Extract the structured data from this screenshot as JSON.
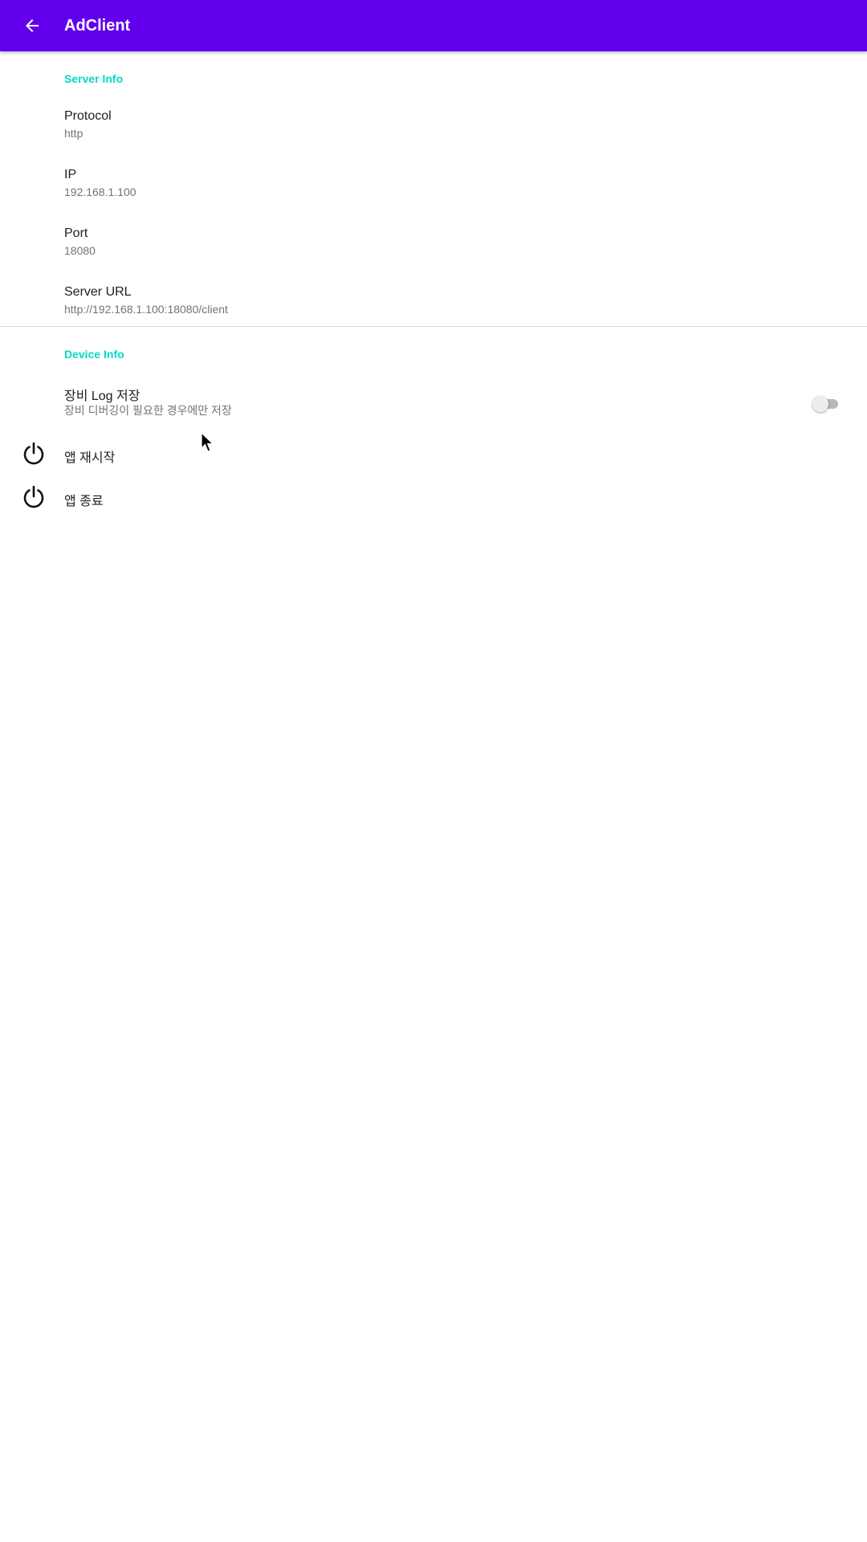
{
  "appbar": {
    "title": "AdClient",
    "back_icon": "arrow-back-icon",
    "background": "#6200ee"
  },
  "server_info": {
    "header": "Server Info",
    "items": [
      {
        "title": "Protocol",
        "summary": "http"
      },
      {
        "title": "IP",
        "summary": "192.168.1.100"
      },
      {
        "title": "Port",
        "summary": "18080"
      },
      {
        "title": "Server URL",
        "summary": "http://192.168.1.100:18080/client"
      }
    ]
  },
  "device_info": {
    "header": "Device Info",
    "log_pref": {
      "title": "장비 Log 저장",
      "summary": "장비 디버깅이 필요한 경우에만 저장",
      "enabled": false
    },
    "actions": [
      {
        "label": "앱 재시작",
        "icon": "power-icon"
      },
      {
        "label": "앱 종료",
        "icon": "power-icon"
      }
    ]
  },
  "colors": {
    "accent": "#03dac5",
    "primary": "#6200ee"
  }
}
